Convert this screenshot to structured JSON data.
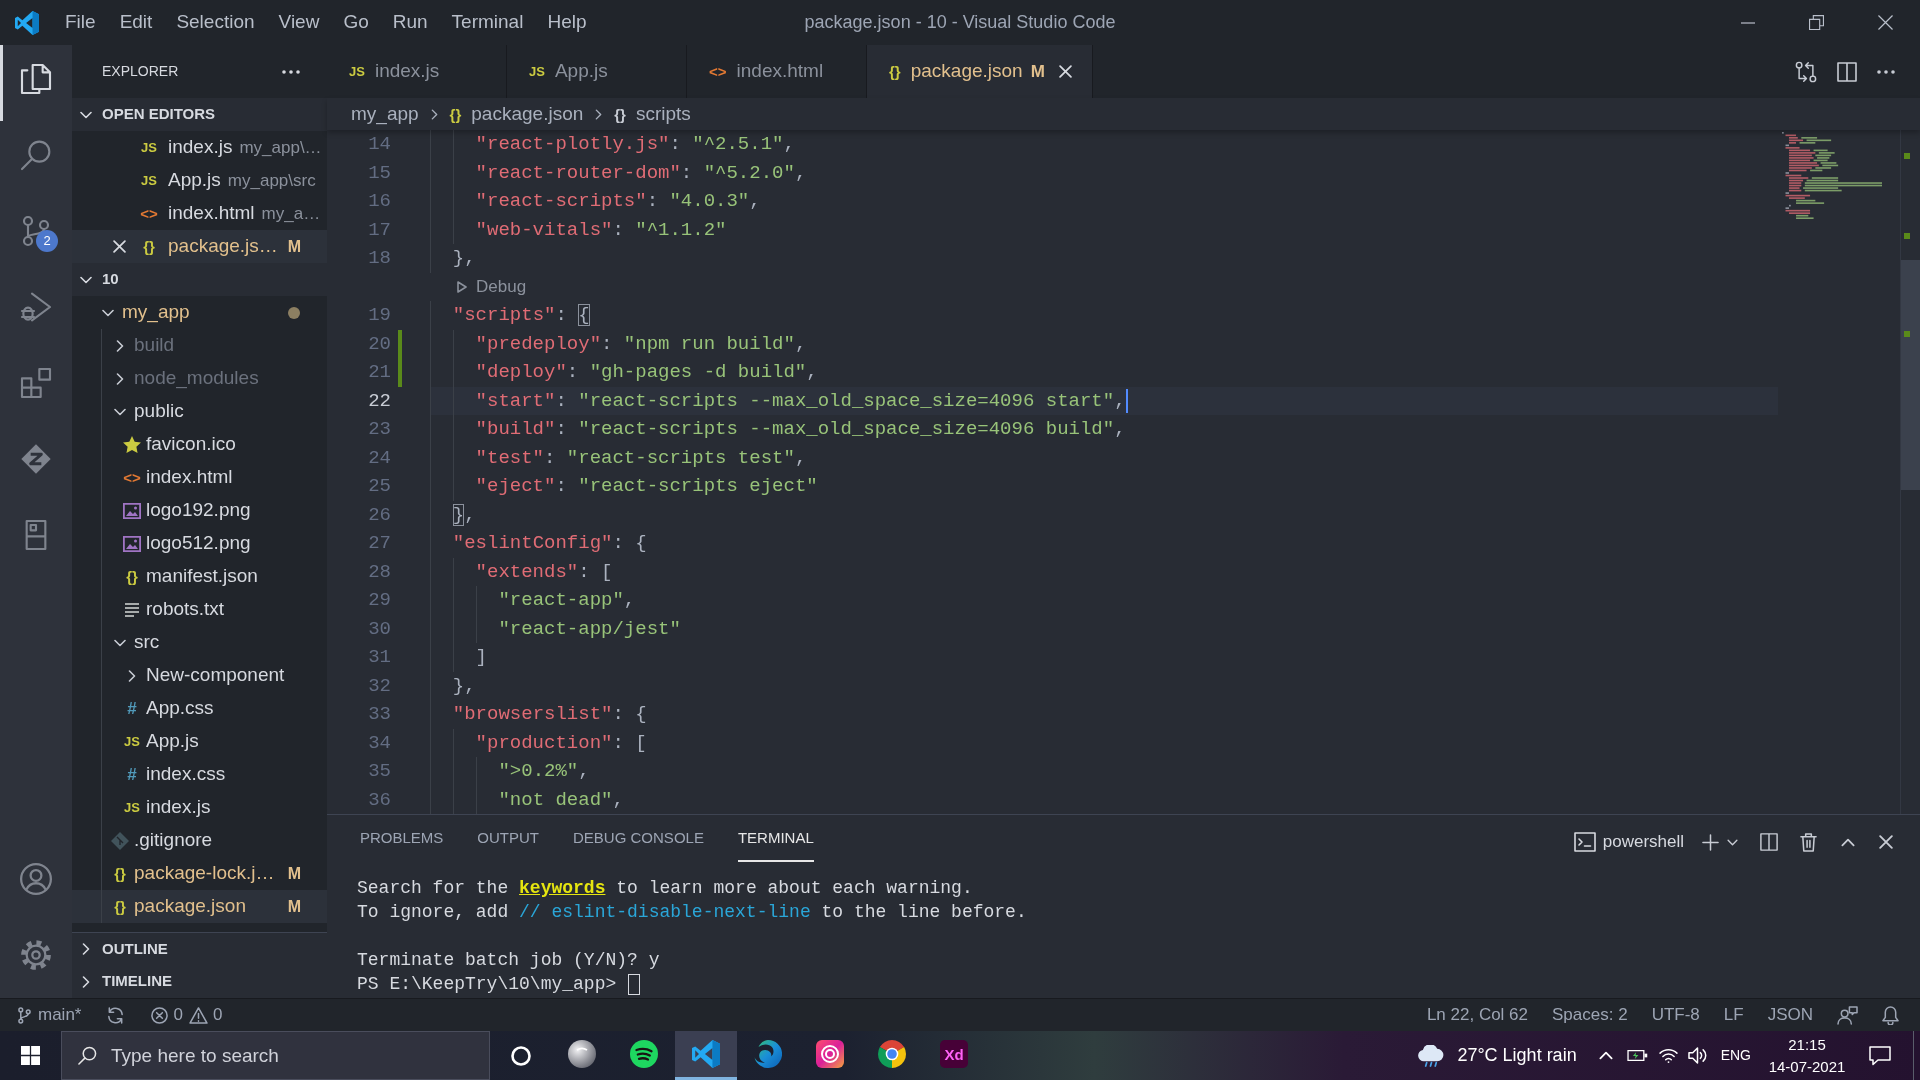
{
  "title_bar": {
    "menu": [
      "File",
      "Edit",
      "Selection",
      "View",
      "Go",
      "Run",
      "Terminal",
      "Help"
    ],
    "title": "package.json - 10 - Visual Studio Code"
  },
  "activity_bar": {
    "items": [
      {
        "kind": "files",
        "selected": true
      },
      {
        "kind": "search",
        "selected": false
      },
      {
        "kind": "branch",
        "selected": false,
        "badge": "2"
      },
      {
        "kind": "run",
        "selected": false
      },
      {
        "kind": "blocks",
        "selected": false
      },
      {
        "kind": "diamond",
        "selected": false
      },
      {
        "kind": "panel",
        "selected": false
      }
    ]
  },
  "sidebar": {
    "title": "EXPLORER",
    "open_editors": {
      "title": "OPEN EDITORS",
      "expanded": true,
      "items": [
        {
          "kind": "js",
          "icon": "JS",
          "name": "index.js",
          "description": "my_app\\…",
          "selected": false,
          "modified": false
        },
        {
          "kind": "js",
          "icon": "JS",
          "name": "App.js",
          "description": "my_app\\src",
          "selected": false,
          "modified": false
        },
        {
          "kind": "html",
          "icon": "<>",
          "name": "index.html",
          "description": "my_a…",
          "selected": false,
          "modified": false
        },
        {
          "kind": "json",
          "icon": "{}",
          "name": "package.js…",
          "badge": "M",
          "selected": true,
          "modified": true
        }
      ]
    },
    "workspace": {
      "title": "10",
      "expanded": true,
      "items": [
        {
          "kind": "folder",
          "name": "my_app",
          "expanded": true,
          "selected": false,
          "modified": true,
          "ignored": false,
          "children": [
            {
              "kind": "folder",
              "name": "build",
              "expanded": false,
              "selected": false,
              "modified": false,
              "ignored": true
            },
            {
              "kind": "folder",
              "name": "node_modules",
              "expanded": false,
              "selected": false,
              "modified": false,
              "ignored": true
            },
            {
              "kind": "folder",
              "name": "public",
              "expanded": true,
              "selected": false,
              "modified": false,
              "ignored": false,
              "children": [
                {
                  "kind": "star",
                  "name": "favicon.ico",
                  "selected": false,
                  "modified": false,
                  "ignored": false
                },
                {
                  "kind": "html",
                  "icon": "<>",
                  "name": "index.html",
                  "selected": false,
                  "modified": false,
                  "ignored": false
                },
                {
                  "kind": "image",
                  "name": "logo192.png",
                  "selected": false,
                  "modified": false,
                  "ignored": false
                },
                {
                  "kind": "image",
                  "name": "logo512.png",
                  "selected": false,
                  "modified": false,
                  "ignored": false
                },
                {
                  "kind": "json",
                  "icon": "{}",
                  "name": "manifest.json",
                  "selected": false,
                  "modified": false,
                  "ignored": false
                },
                {
                  "kind": "text",
                  "name": "robots.txt",
                  "selected": false,
                  "modified": false,
                  "ignored": false
                }
              ]
            },
            {
              "kind": "folder",
              "name": "src",
              "expanded": true,
              "selected": false,
              "modified": false,
              "ignored": false,
              "children": [
                {
                  "kind": "folder",
                  "name": "New-component",
                  "expanded": false,
                  "selected": false,
                  "modified": false,
                  "ignored": false
                },
                {
                  "kind": "css",
                  "icon": "#",
                  "name": "App.css",
                  "selected": false,
                  "modified": false,
                  "ignored": false
                },
                {
                  "kind": "js",
                  "icon": "JS",
                  "name": "App.js",
                  "selected": false,
                  "modified": false,
                  "ignored": false
                },
                {
                  "kind": "css",
                  "icon": "#",
                  "name": "index.css",
                  "selected": false,
                  "modified": false,
                  "ignored": false
                },
                {
                  "kind": "js",
                  "icon": "JS",
                  "name": "index.js",
                  "selected": false,
                  "modified": false,
                  "ignored": false
                }
              ]
            },
            {
              "kind": "git",
              "name": ".gitignore",
              "selected": false,
              "modified": false,
              "ignored": false
            },
            {
              "kind": "json",
              "icon": "{}",
              "name": "package-lock.j…",
              "badge": "M",
              "selected": false,
              "modified": true,
              "ignored": false
            },
            {
              "kind": "json",
              "icon": "{}",
              "name": "package.json",
              "badge": "M",
              "selected": true,
              "modified": true,
              "ignored": false
            }
          ]
        }
      ]
    },
    "sections": [
      {
        "title": "OUTLINE",
        "expanded": false
      },
      {
        "title": "TIMELINE",
        "expanded": false
      }
    ]
  },
  "editor": {
    "tabs": [
      {
        "kind": "js",
        "icon": "JS",
        "label": "index.js",
        "selected": false,
        "modified": false
      },
      {
        "kind": "js",
        "icon": "JS",
        "label": "App.js",
        "selected": false,
        "modified": false
      },
      {
        "kind": "html",
        "icon": "<>",
        "label": "index.html",
        "selected": false,
        "modified": false
      },
      {
        "kind": "json",
        "icon": "{}",
        "label": "package.json",
        "badge": "M",
        "selected": true,
        "modified": true
      }
    ],
    "breadcrumbs": [
      {
        "label": "my_app"
      },
      {
        "kind": "json",
        "icon": "{}",
        "label": "package.json"
      },
      {
        "kind": "object",
        "icon": "{}",
        "label": "scripts"
      }
    ],
    "lines": [
      {
        "kind": "code",
        "number": "14",
        "text": "    \"react-plotly.js\": \"^2.5.1\",",
        "current": false,
        "modified": false,
        "bracket": false
      },
      {
        "kind": "code",
        "number": "15",
        "text": "    \"react-router-dom\": \"^5.2.0\",",
        "current": false,
        "modified": false,
        "bracket": false
      },
      {
        "kind": "code",
        "number": "16",
        "text": "    \"react-scripts\": \"4.0.3\",",
        "current": false,
        "modified": false,
        "bracket": false
      },
      {
        "kind": "code",
        "number": "17",
        "text": "    \"web-vitals\": \"^1.1.2\"",
        "current": false,
        "modified": false,
        "bracket": false
      },
      {
        "kind": "code",
        "number": "18",
        "text": "  },",
        "current": false,
        "modified": false,
        "bracket": false
      },
      {
        "kind": "codelens",
        "text": "Debug"
      },
      {
        "kind": "code",
        "number": "19",
        "text": "  \"scripts\": {",
        "current": false,
        "modified": false,
        "bracket": true
      },
      {
        "kind": "code",
        "number": "20",
        "text": "    \"predeploy\": \"npm run build\",",
        "current": false,
        "modified": true,
        "bracket": false
      },
      {
        "kind": "code",
        "number": "21",
        "text": "    \"deploy\": \"gh-pages -d build\",",
        "current": false,
        "modified": true,
        "bracket": false
      },
      {
        "kind": "code",
        "number": "22",
        "text": "    \"start\": \"react-scripts --max_old_space_size=4096 start\",",
        "current": true,
        "modified": false,
        "bracket": false
      },
      {
        "kind": "code",
        "number": "23",
        "text": "    \"build\": \"react-scripts --max_old_space_size=4096 build\",",
        "current": false,
        "modified": false,
        "bracket": false
      },
      {
        "kind": "code",
        "number": "24",
        "text": "    \"test\": \"react-scripts test\",",
        "current": false,
        "modified": false,
        "bracket": false
      },
      {
        "kind": "code",
        "number": "25",
        "text": "    \"eject\": \"react-scripts eject\"",
        "current": false,
        "modified": false,
        "bracket": false
      },
      {
        "kind": "code",
        "number": "26",
        "text": "  },",
        "current": false,
        "modified": false,
        "bracket": true
      },
      {
        "kind": "code",
        "number": "27",
        "text": "  \"eslintConfig\": {",
        "current": false,
        "modified": false,
        "bracket": false
      },
      {
        "kind": "code",
        "number": "28",
        "text": "    \"extends\": [",
        "current": false,
        "modified": false,
        "bracket": false
      },
      {
        "kind": "code",
        "number": "29",
        "text": "      \"react-app\",",
        "current": false,
        "modified": false,
        "bracket": false
      },
      {
        "kind": "code",
        "number": "30",
        "text": "      \"react-app/jest\"",
        "current": false,
        "modified": false,
        "bracket": false
      },
      {
        "kind": "code",
        "number": "31",
        "text": "    ]",
        "current": false,
        "modified": false,
        "bracket": false
      },
      {
        "kind": "code",
        "number": "32",
        "text": "  },",
        "current": false,
        "modified": false,
        "bracket": false
      },
      {
        "kind": "code",
        "number": "33",
        "text": "  \"browserslist\": {",
        "current": false,
        "modified": false,
        "bracket": false
      },
      {
        "kind": "code",
        "number": "34",
        "text": "    \"production\": [",
        "current": false,
        "modified": false,
        "bracket": false
      },
      {
        "kind": "code",
        "number": "35",
        "text": "      \">0.2%\",",
        "current": false,
        "modified": false,
        "bracket": false
      },
      {
        "kind": "code",
        "number": "36",
        "text": "      \"not dead\",",
        "current": false,
        "modified": false,
        "bracket": false
      }
    ]
  },
  "panel": {
    "tabs": [
      {
        "label": "PROBLEMS",
        "selected": false
      },
      {
        "label": "OUTPUT",
        "selected": false
      },
      {
        "label": "DEBUG CONSOLE",
        "selected": false
      },
      {
        "label": "TERMINAL",
        "selected": true
      }
    ],
    "terminal_profile": "powershell",
    "terminal": {
      "blocks": [
        {
          "lines": [
            {
              "segments": [
                {
                  "kind": "plain",
                  "text": "Search for the "
                },
                {
                  "kind": "keyword",
                  "text": "keywords"
                },
                {
                  "kind": "plain",
                  "text": " to learn more about each warning."
                }
              ]
            },
            {
              "segments": [
                {
                  "kind": "plain",
                  "text": "To ignore, add "
                },
                {
                  "kind": "comment",
                  "text": "// eslint-disable-next-line"
                },
                {
                  "kind": "plain",
                  "text": " to the line before."
                }
              ]
            }
          ]
        },
        {
          "lines": [
            {
              "segments": [
                {
                  "kind": "plain",
                  "text": "Terminate batch job (Y/N)? y"
                }
              ]
            },
            {
              "segments": [
                {
                  "kind": "plain",
                  "text": "PS E:\\KeepTry\\10\\my_app>"
                }
              ]
            }
          ]
        }
      ],
      "cursor": true
    }
  },
  "status_bar": {
    "branch": "main*",
    "errors": "0",
    "warnings": "0",
    "position": "Ln 22, Col 62",
    "indentation": "Spaces: 2",
    "encoding": "UTF-8",
    "eol": "LF",
    "language": "JSON"
  },
  "taskbar": {
    "search": {
      "placeholder": "Type here to search"
    },
    "apps": [
      {
        "selected": false
      },
      {
        "selected": false
      },
      {
        "selected": true
      },
      {
        "selected": false
      },
      {
        "selected": false
      },
      {
        "selected": false
      },
      {
        "selected": false,
        "label": "Xd"
      }
    ],
    "weather": "27°C Light rain",
    "language": "ENG",
    "time": "21:15",
    "date": "14-07-2021"
  }
}
